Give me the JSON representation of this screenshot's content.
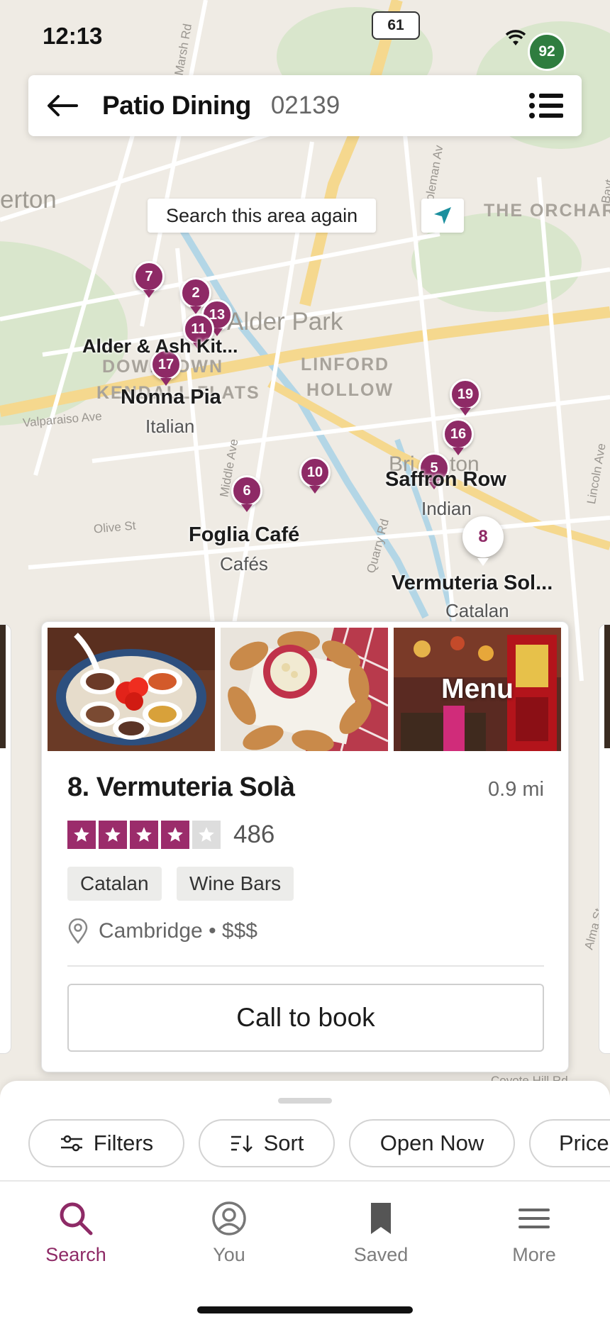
{
  "status_bar": {
    "time": "12:13",
    "route_number": "61",
    "battery": "92"
  },
  "header": {
    "title": "Patio Dining",
    "zip": "02139"
  },
  "map": {
    "search_again_label": "Search this area again",
    "streets": [
      "Marsh Rd",
      "Coleman Av",
      "Valparaiso Ave",
      "Middle Ave",
      "Olive St",
      "Quarry Rd",
      "Lincoln Ave",
      "Alma St",
      "Coyote Hill Rd",
      "Bayt"
    ],
    "areas": [
      "erton",
      "Alder Park",
      "THE ORCHAR",
      "DOWNTOWN",
      "KENDALL FLATS",
      "LINFORD",
      "HOLLOW",
      "Bri",
      "ton"
    ],
    "pins": [
      "7",
      "2",
      "13",
      "11",
      "17",
      "19",
      "16",
      "5",
      "6",
      "10",
      "8"
    ],
    "restaurants": [
      {
        "name": "Alder & Ash Kit...",
        "category": ""
      },
      {
        "name": "Nonna Pia",
        "category": "Italian"
      },
      {
        "name": "Saffron Row",
        "category": "Indian"
      },
      {
        "name": "Foglia Café",
        "category": "Cafés"
      },
      {
        "name": "Vermuteria Sol...",
        "category": "Catalan"
      }
    ]
  },
  "card": {
    "menu_label": "Menu",
    "name": "8. Vermuteria Solà",
    "distance": "0.9 mi",
    "rating": 4,
    "rating_max": 5,
    "review_count": "486",
    "tags": [
      "Catalan",
      "Wine Bars"
    ],
    "location": "Cambridge • $$$",
    "cta": "Call to book"
  },
  "filters": [
    "Filters",
    "Sort",
    "Open Now",
    "Price"
  ],
  "tabs": [
    {
      "label": "Search",
      "active": true
    },
    {
      "label": "You",
      "active": false
    },
    {
      "label": "Saved",
      "active": false
    },
    {
      "label": "More",
      "active": false
    }
  ],
  "colors": {
    "brand": "#8e2a66",
    "map_bg": "#efebe4",
    "park": "#d6e6c9",
    "highway": "#f5d68a",
    "water": "#a9d3e8"
  }
}
